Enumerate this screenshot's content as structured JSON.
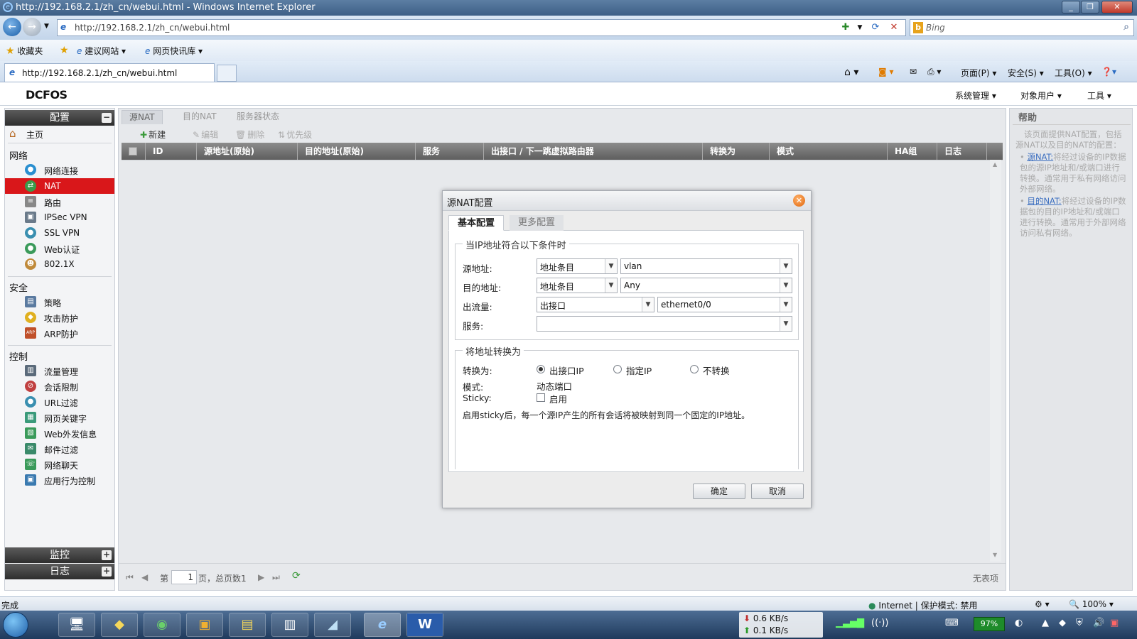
{
  "browser": {
    "window_title": "http://192.168.2.1/zh_cn/webui.html - Windows Internet Explorer",
    "address": "http://192.168.2.1/zh_cn/webui.html",
    "search_placeholder": "Bing",
    "favorites_label": "收藏夹",
    "suggested_sites": "建议网站",
    "web_slice": "网页快讯库",
    "tab_title": "http://192.168.2.1/zh_cn/webui.html",
    "cmd_page": "页面(P)",
    "cmd_safety": "安全(S)",
    "cmd_tools": "工具(O)",
    "status_text": "完成",
    "zone_text": "Internet | 保护模式: 禁用",
    "zoom": "100%"
  },
  "app": {
    "logo": "DCFOS",
    "menu": [
      "系统管理",
      "对象用户",
      "工具"
    ]
  },
  "sidebar": {
    "header": "配置",
    "home": "主页",
    "sections": [
      {
        "title": "网络",
        "items": [
          "网络连接",
          "NAT",
          "路由",
          "IPSec VPN",
          "SSL VPN",
          "Web认证",
          "802.1X"
        ]
      },
      {
        "title": "安全",
        "items": [
          "策略",
          "攻击防护",
          "ARP防护"
        ]
      },
      {
        "title": "控制",
        "items": [
          "流量管理",
          "会话限制",
          "URL过滤",
          "网页关键字",
          "Web外发信息",
          "邮件过滤",
          "网络聊天",
          "应用行为控制"
        ]
      }
    ],
    "active_item": "NAT",
    "footer": [
      "监控",
      "日志"
    ]
  },
  "main": {
    "tabs": [
      "源NAT",
      "目的NAT",
      "服务器状态"
    ],
    "toolbar": [
      "新建",
      "编辑",
      "删除",
      "优先级"
    ],
    "columns": [
      "ID",
      "源地址(原始)",
      "目的地址(原始)",
      "服务",
      "出接口 / 下一跳虚拟路由器",
      "转换为",
      "模式",
      "HA组",
      "日志"
    ],
    "pager": {
      "prefix": "第",
      "page": "1",
      "suffix": "页，总页数1",
      "empty": "无表项"
    }
  },
  "help": {
    "title": "帮助",
    "intro": "该页面提供NAT配置，包括源NAT以及目的NAT的配置：",
    "items": [
      {
        "link": "源NAT:",
        "text": "将经过设备的IP数据包的源IP地址和/或端口进行转换。通常用于私有网络访问外部网络。"
      },
      {
        "link": "目的NAT:",
        "text": "将经过设备的IP数据包的目的IP地址和/或端口进行转换。通常用于外部网络访问私有网络。"
      }
    ]
  },
  "dialog": {
    "title": "源NAT配置",
    "tabs": [
      "基本配置",
      "更多配置"
    ],
    "condition_legend": "当IP地址符合以下条件时",
    "src_label": "源地址:",
    "src_type": "地址条目",
    "src_value": "vlan",
    "dst_label": "目的地址:",
    "dst_type": "地址条目",
    "dst_value": "Any",
    "egress_label": "出流量:",
    "egress_type": "出接口",
    "egress_value": "ethernet0/0",
    "service_label": "服务:",
    "service_value": "",
    "translate_legend": "将地址转换为",
    "translate_label": "转换为:",
    "translate_options": [
      "出接口IP",
      "指定IP",
      "不转换"
    ],
    "translate_selected": "出接口IP",
    "mode_label": "模式:",
    "mode_value": "动态端口",
    "sticky_label": "Sticky:",
    "sticky_option": "启用",
    "sticky_checked": false,
    "sticky_note": "启用sticky后，每一个源IP产生的所有会话将被映射到同一个固定的IP地址。",
    "ok": "确定",
    "cancel": "取消"
  },
  "taskbar": {
    "down_speed": "0.6 KB/s",
    "up_speed": "0.1 KB/s",
    "battery": "97%"
  }
}
